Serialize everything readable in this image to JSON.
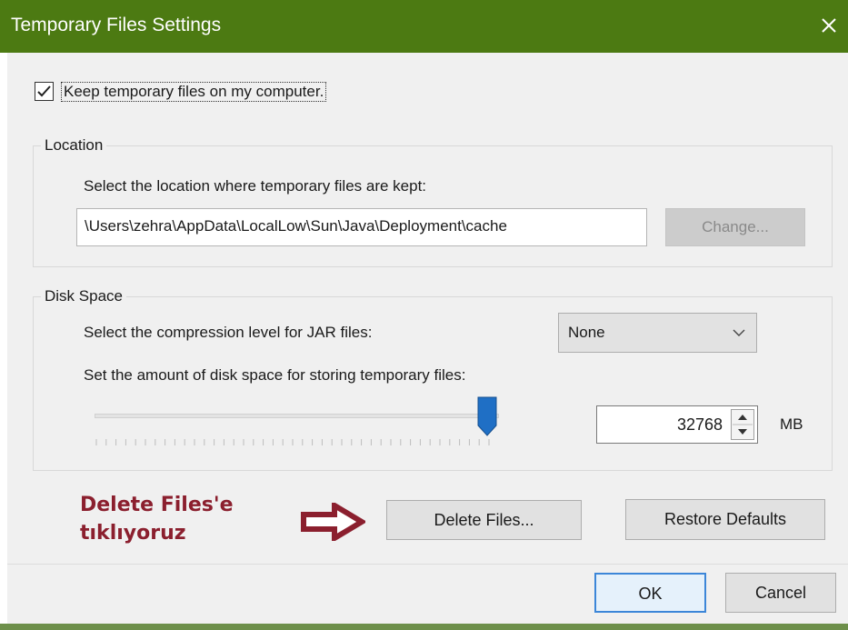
{
  "window": {
    "title": "Temporary Files Settings",
    "close_icon": "close-icon",
    "title_bar_color": "#4c7a12"
  },
  "keep_files": {
    "label": "Keep temporary files on my computer.",
    "checked": true
  },
  "location": {
    "group_title": "Location",
    "description": "Select the location where temporary files are kept:",
    "path": "\\Users\\zehra\\AppData\\LocalLow\\Sun\\Java\\Deployment\\cache",
    "change_button": "Change...",
    "change_enabled": false
  },
  "disk_space": {
    "group_title": "Disk Space",
    "compression_label": "Select the compression level for JAR files:",
    "compression_value": "None",
    "space_label": "Set the amount of disk space for storing temporary files:",
    "slider_fraction": 0.97,
    "spinner_value": "32768",
    "unit": "MB"
  },
  "annotation": {
    "line1": "Delete Files'e",
    "line2": "tıklıyoruz",
    "color": "#8b1f2e"
  },
  "actions": {
    "delete_button": "Delete Files...",
    "restore_button": "Restore Defaults"
  },
  "footer": {
    "ok_button": "OK",
    "cancel_button": "Cancel"
  }
}
